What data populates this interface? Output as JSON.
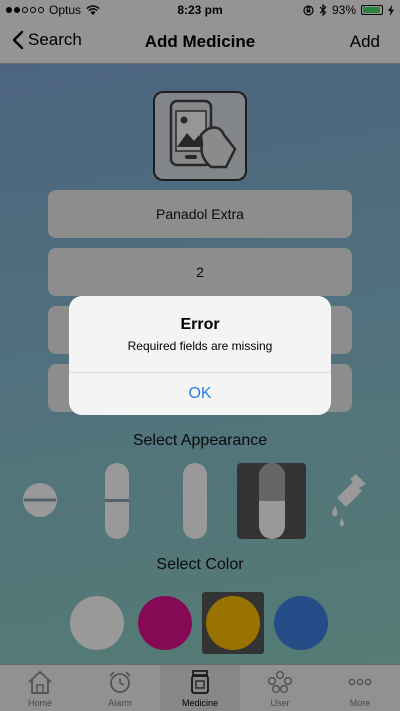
{
  "status_bar": {
    "carrier": "Optus",
    "time": "8:23 pm",
    "battery": "93%",
    "battery_level": 0.93
  },
  "nav": {
    "back_label": "Search",
    "title": "Add Medicine",
    "action_label": "Add"
  },
  "form": {
    "photo_icon": "photo-upload-icon",
    "name_value": "Panadol Extra",
    "quantity_value": "2",
    "field3_value": "",
    "field4_value": "",
    "appearance_label": "Select Appearance",
    "appearance_options": [
      "tablet-icon",
      "capsule-icon",
      "caplet-icon",
      "capsule-split-icon",
      "liquid-drops-icon"
    ],
    "appearance_selected": "capsule-split-icon",
    "color_label": "Select Color",
    "colors": [
      "#ffffff",
      "#e0108f",
      "#ffc000",
      "#3f7fe0"
    ],
    "color_selected": "#ffc000"
  },
  "alert": {
    "title": "Error",
    "message": "Required fields are missing",
    "ok_label": "OK"
  },
  "tab_bar": {
    "tabs": [
      {
        "label": "Home",
        "icon": "home-icon"
      },
      {
        "label": "Alarm",
        "icon": "alarm-clock-icon"
      },
      {
        "label": "Medicine",
        "icon": "medicine-bottle-icon"
      },
      {
        "label": "User",
        "icon": "users-icon"
      },
      {
        "label": "More",
        "icon": "more-icon"
      }
    ],
    "active": "Medicine"
  }
}
